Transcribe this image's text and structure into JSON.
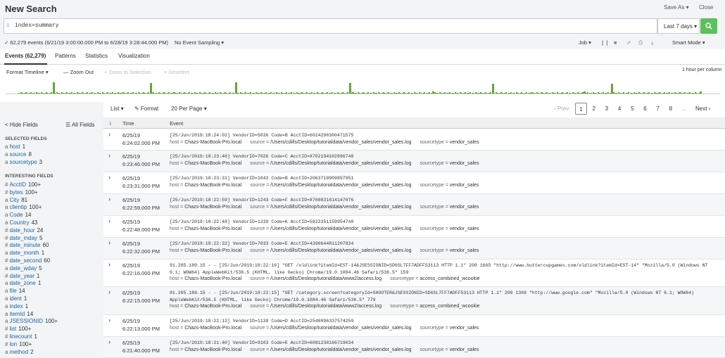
{
  "header": {
    "title": "New Search",
    "save_as": "Save As ▾",
    "close": "Close"
  },
  "search": {
    "line_number": "1",
    "query": "index=summary",
    "time_range": "Last 7 days ▾"
  },
  "status": {
    "event_count": "✓ 62,279 events (6/21/19 3:00:00.000 PM to 6/28/19 3:28:44.000 PM)",
    "sampling": "No Event Sampling ▾",
    "job": "Job ▾",
    "smart_mode": "Smart Mode ▾"
  },
  "tabs": [
    {
      "label": "Events (62,279)"
    },
    {
      "label": "Patterns"
    },
    {
      "label": "Statistics"
    },
    {
      "label": "Visualization"
    }
  ],
  "timeline": {
    "format": "Format Timeline ▾",
    "zoom_out": "— Zoom Out",
    "zoom_sel": "+ Zoom to Selection",
    "deselect": "× Deselect",
    "scale": "1 hour per column"
  },
  "sidebar": {
    "hide_fields": "< Hide Fields",
    "all_fields": "☰ All Fields",
    "selected_heading": "SELECTED FIELDS",
    "interesting_heading": "INTERESTING FIELDS",
    "selected": [
      {
        "type": "a",
        "name": "host",
        "count": "1"
      },
      {
        "type": "a",
        "name": "source",
        "count": "8"
      },
      {
        "type": "a",
        "name": "sourcetype",
        "count": "3"
      }
    ],
    "interesting": [
      {
        "type": "#",
        "name": "AcctID",
        "count": "100+"
      },
      {
        "type": "#",
        "name": "bytes",
        "count": "100+"
      },
      {
        "type": "a",
        "name": "City",
        "count": "81"
      },
      {
        "type": "a",
        "name": "clientip",
        "count": "100+"
      },
      {
        "type": "a",
        "name": "Code",
        "count": "14"
      },
      {
        "type": "a",
        "name": "Country",
        "count": "43"
      },
      {
        "type": "#",
        "name": "date_hour",
        "count": "24"
      },
      {
        "type": "#",
        "name": "date_mday",
        "count": "5"
      },
      {
        "type": "#",
        "name": "date_minute",
        "count": "60"
      },
      {
        "type": "a",
        "name": "date_month",
        "count": "1"
      },
      {
        "type": "#",
        "name": "date_second",
        "count": "60"
      },
      {
        "type": "a",
        "name": "date_wday",
        "count": "5"
      },
      {
        "type": "#",
        "name": "date_year",
        "count": "1"
      },
      {
        "type": "a",
        "name": "date_zone",
        "count": "1"
      },
      {
        "type": "a",
        "name": "file",
        "count": "14"
      },
      {
        "type": "a",
        "name": "ident",
        "count": "1"
      },
      {
        "type": "a",
        "name": "index",
        "count": "1"
      },
      {
        "type": "a",
        "name": "itemId",
        "count": "14"
      },
      {
        "type": "a",
        "name": "JSESSIONID",
        "count": "100+"
      },
      {
        "type": "#",
        "name": "list",
        "count": "100+"
      },
      {
        "type": "#",
        "name": "linecount",
        "count": "1"
      },
      {
        "type": "#",
        "name": "lon",
        "count": "100+"
      },
      {
        "type": "a",
        "name": "method",
        "count": "2"
      }
    ]
  },
  "listbar": {
    "list": "List ▾",
    "format": "✎ Format",
    "per_page": "20 Per Page ▾",
    "prev": "‹ Prev",
    "pages": [
      "1",
      "2",
      "3",
      "4",
      "5",
      "6",
      "7",
      "8"
    ],
    "ellipsis": "...",
    "next": "Next ›"
  },
  "table": {
    "col_info": "i",
    "col_time": "Time",
    "col_event": "Event"
  },
  "events": [
    {
      "date": "6/25/19",
      "time": "6:24:02.000 PM",
      "raw": "[25/Jun/2019:18:24:02] VendorID=5036 Code=B AcctID=6024298300471575",
      "host": "Chazs-MacBook-Pro.local",
      "source": "/Users/cdills/Desktop/tutorialdata/vendor_sales/vendor_sales.log",
      "sourcetype": "vendor_sales"
    },
    {
      "date": "6/25/19",
      "time": "6:23:46.000 PM",
      "raw": "[25/Jun/2019:18:23:46] VendorID=7026 Code=C AcctID=8702194102896748",
      "host": "Chazs-MacBook-Pro.local",
      "source": "/Users/cdills/Desktop/tutorialdata/vendor_sales/vendor_sales.log",
      "sourcetype": "vendor_sales"
    },
    {
      "date": "6/25/19",
      "time": "6:23:31.000 PM",
      "raw": "[25/Jun/2019:18:23:31] VendorID=1043 Code=B AcctID=2063718909897951",
      "host": "Chazs-MacBook-Pro.local",
      "source": "/Users/cdills/Desktop/tutorialdata/vendor_sales/vendor_sales.log",
      "sourcetype": "vendor_sales"
    },
    {
      "date": "6/25/19",
      "time": "6:22:59.000 PM",
      "raw": "[25/Jun/2019:18:22:59] VendorID=1243 Code=F AcctID=8768831614147676",
      "host": "Chazs-MacBook-Pro.local",
      "source": "/Users/cdills/Desktop/tutorialdata/vendor_sales/vendor_sales.log",
      "sourcetype": "vendor_sales"
    },
    {
      "date": "6/25/19",
      "time": "6:22:48.000 PM",
      "raw": "[25/Jun/2019:18:22:48] VendorID=1239 Code=K AcctID=5822351159954740",
      "host": "Chazs-MacBook-Pro.local",
      "source": "/Users/cdills/Desktop/tutorialdata/vendor_sales/vendor_sales.log",
      "sourcetype": "vendor_sales"
    },
    {
      "date": "6/25/19",
      "time": "6:22:32.000 PM",
      "raw": "[25/Jun/2019:18:22:32] VendorID=7033 Code=E AcctID=4390644811207834",
      "host": "Chazs-MacBook-Pro.local",
      "source": "/Users/cdills/Desktop/tutorialdata/vendor_sales/vendor_sales.log",
      "sourcetype": "vendor_sales"
    },
    {
      "date": "6/25/19",
      "time": "6:22:16.000 PM",
      "raw": "91.205.189.15 - - [25/Jun/2019:18:22:16] \"GET /oldlink?itemId=EST-14&JSESSIONID=SD6SL7FF7ADFF53113 HTTP 1.1\" 200 1665 \"http://www.buttercupgames.com/oldlink?itemId=EST-14\" \"Mozilla/5.0 (Windows NT 6.1; WOW64) AppleWebKit/536.5 (KHTML, like Gecko) Chrome/19.0.1084.46 Safari/536.5\" 159",
      "host": "Chazs-MacBook-Pro.local",
      "source": "/Users/cdills/Desktop/tutorialdata/www2/access.log",
      "sourcetype": "access_combined_wcookie"
    },
    {
      "date": "6/25/19",
      "time": "6:22:15.000 PM",
      "raw": "91.205.189.15 - - [25/Jun/2019:18:22:15] \"GET /category.screen?categoryId=SHOOTER&JSESSIONID=SD6SL7FF7ADFF53113 HTTP 1.1\" 200 1369 \"http://www.google.com\" \"Mozilla/5.0 (Windows NT 6.1; WOW64) AppleWebKit/536.5 (KHTML, like Gecko) Chrome/19.0.1084.46 Safari/536.5\" 779",
      "host": "Chazs-MacBook-Pro.local",
      "source": "/Users/cdills/Desktop/tutorialdata/www2/access.log",
      "sourcetype": "access_combined_wcookie"
    },
    {
      "date": "6/25/19",
      "time": "6:22:13.000 PM",
      "raw": "[25/Jun/2019:18:22:13] VendorID=1139 Code=D AcctID=2548096337574259",
      "host": "Chazs-MacBook-Pro.local",
      "source": "/Users/cdills/Desktop/tutorialdata/vendor_sales/vendor_sales.log",
      "sourcetype": "vendor_sales"
    },
    {
      "date": "6/25/19",
      "time": "6:21:40.000 PM",
      "raw": "[25/Jun/2019:18:21:40] VendorID=9103 Code=E AcctID=6081238166719034",
      "host": "Chazs-MacBook-Pro.local",
      "source": "/Users/cdills/Desktop/tutorialdata/vendor_sales/vendor_sales.log",
      "sourcetype": "vendor_sales"
    }
  ],
  "labels": {
    "host": "host =",
    "source": "source =",
    "sourcetype": "sourcetype ="
  },
  "colors": {
    "accent": "#65a637",
    "go_button": "#5cc05c"
  }
}
